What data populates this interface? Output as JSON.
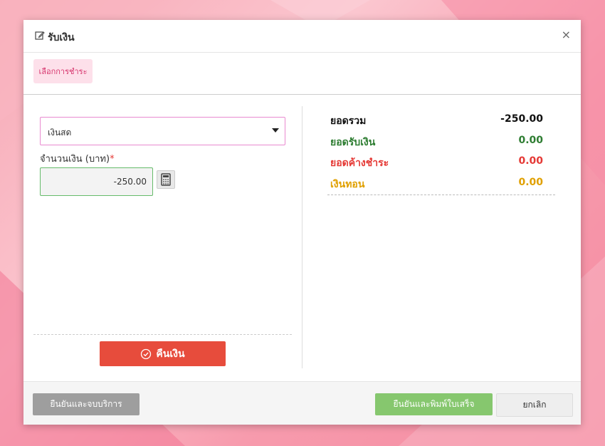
{
  "dialog": {
    "title": "รับเงิน",
    "close_symbol": "×"
  },
  "tab": {
    "label": "เลือกการชำระ"
  },
  "form": {
    "payment_method": "เงินสด",
    "amount_label": "จำนวนเงิน (บาท)",
    "required_mark": "*",
    "amount_value": "-250.00"
  },
  "actions": {
    "refund_label": "คืนเงิน"
  },
  "summary": {
    "rows": [
      {
        "label": "ยอดรวม",
        "value": "-250.00",
        "color": "#111111"
      },
      {
        "label": "ยอดรับเงิน",
        "value": "0.00",
        "color": "#2e7d32"
      },
      {
        "label": "ยอดค้างชำระ",
        "value": "0.00",
        "color": "#e53935"
      },
      {
        "label": "เงินทอน",
        "value": "0.00",
        "color": "#e0a000"
      }
    ]
  },
  "footer": {
    "finish_label": "ยืนยันและจบบริการ",
    "print_label": "ยืนยันและพิมพ์ใบเสร็จ",
    "cancel_label": "ยกเลิก"
  },
  "icons": [
    "edit-icon",
    "close-icon",
    "dropdown-caret-icon",
    "calculator-icon",
    "check-circle-icon"
  ],
  "colors": {
    "accent": "#e74c3c",
    "tab_bg": "#fde0ea",
    "tab_text": "#d6336c",
    "select_border": "#e98ad0",
    "confirm_print": "#86c76e",
    "confirm_finish": "#9e9e9e"
  }
}
